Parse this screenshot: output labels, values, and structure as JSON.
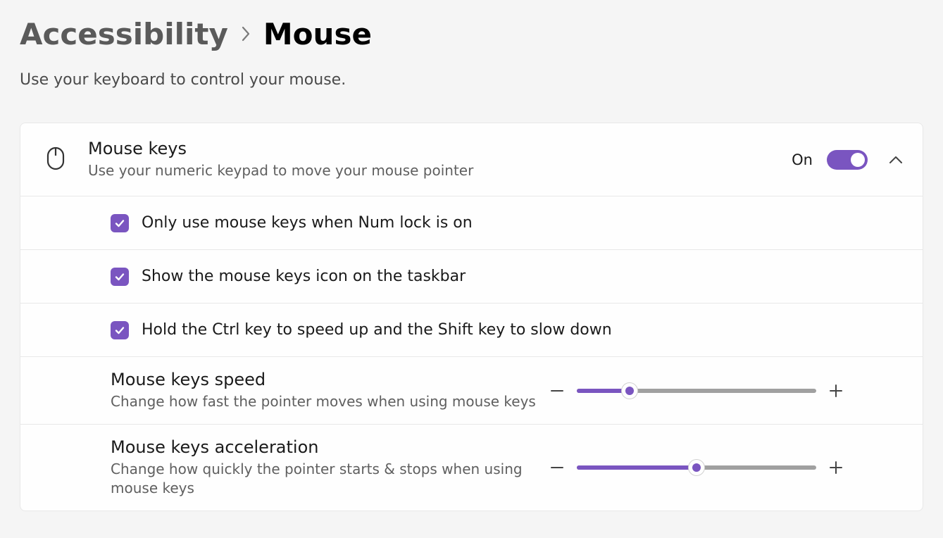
{
  "breadcrumb": {
    "parent": "Accessibility",
    "current": "Mouse"
  },
  "subtitle": "Use your keyboard to control your mouse.",
  "mouseKeys": {
    "title": "Mouse keys",
    "description": "Use your numeric keypad to move your mouse pointer",
    "toggleState": "On",
    "toggleOn": true,
    "expanded": true
  },
  "options": [
    {
      "label": "Only use mouse keys when Num lock is on",
      "checked": true
    },
    {
      "label": "Show the mouse keys icon on the taskbar",
      "checked": true
    },
    {
      "label": "Hold the Ctrl key to speed up and the Shift key to slow down",
      "checked": true
    }
  ],
  "sliders": {
    "speed": {
      "title": "Mouse keys speed",
      "description": "Change how fast the pointer moves when using mouse keys",
      "percent": 22
    },
    "acceleration": {
      "title": "Mouse keys acceleration",
      "description": "Change how quickly the pointer starts & stops when using mouse keys",
      "percent": 50
    }
  },
  "colors": {
    "accent": "#7a55c0"
  }
}
